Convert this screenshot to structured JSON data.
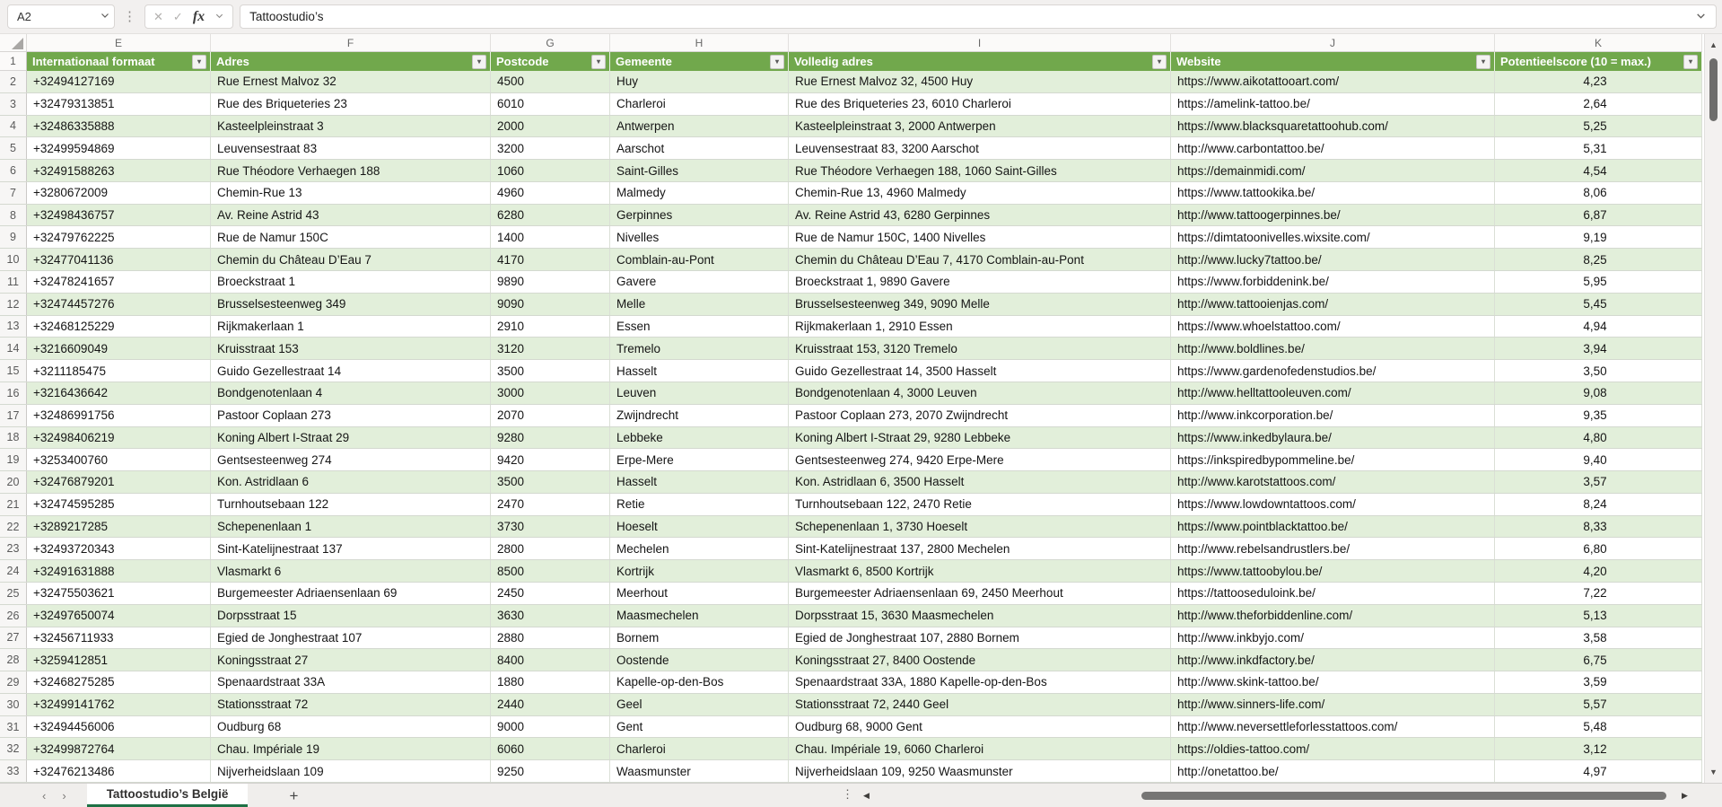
{
  "name_box": {
    "value": "A2"
  },
  "formula_bar": {
    "value": "Tattoostudio’s"
  },
  "column_letters": [
    "E",
    "F",
    "G",
    "H",
    "I",
    "J",
    "K"
  ],
  "table": {
    "header_row_number": "1",
    "headers": [
      "Internationaal formaat",
      "Adres",
      "Postcode",
      "Gemeente",
      "Volledig adres",
      "Website",
      "Potentieelscore (10 = max.)"
    ],
    "rows": [
      [
        "+32494127169",
        "Rue Ernest Malvoz 32",
        "4500",
        "Huy",
        "Rue Ernest Malvoz 32, 4500 Huy",
        "https://www.aikotattooart.com/",
        "4,23"
      ],
      [
        "+32479313851",
        "Rue des Briqueteries 23",
        "6010",
        "Charleroi",
        "Rue des Briqueteries 23, 6010 Charleroi",
        "https://amelink-tattoo.be/",
        "2,64"
      ],
      [
        "+32486335888",
        "Kasteelpleinstraat 3",
        "2000",
        "Antwerpen",
        "Kasteelpleinstraat 3, 2000 Antwerpen",
        "https://www.blacksquaretattoohub.com/",
        "5,25"
      ],
      [
        "+32499594869",
        "Leuvensestraat 83",
        "3200",
        "Aarschot",
        "Leuvensestraat 83, 3200 Aarschot",
        "http://www.carbontattoo.be/",
        "5,31"
      ],
      [
        "+32491588263",
        "Rue Théodore Verhaegen 188",
        "1060",
        "Saint-Gilles",
        "Rue Théodore Verhaegen 188, 1060 Saint-Gilles",
        "https://demainmidi.com/",
        "4,54"
      ],
      [
        "+3280672009",
        "Chemin-Rue 13",
        "4960",
        "Malmedy",
        "Chemin-Rue 13, 4960 Malmedy",
        "https://www.tattookika.be/",
        "8,06"
      ],
      [
        "+32498436757",
        "Av. Reine Astrid 43",
        "6280",
        "Gerpinnes",
        "Av. Reine Astrid 43, 6280 Gerpinnes",
        "http://www.tattoogerpinnes.be/",
        "6,87"
      ],
      [
        "+32479762225",
        "Rue de Namur 150C",
        "1400",
        "Nivelles",
        "Rue de Namur 150C, 1400 Nivelles",
        "https://dimtatoonivelles.wixsite.com/",
        "9,19"
      ],
      [
        "+32477041136",
        "Chemin du Château D’Eau 7",
        "4170",
        "Comblain-au-Pont",
        "Chemin du Château D’Eau 7, 4170 Comblain-au-Pont",
        "http://www.lucky7tattoo.be/",
        "8,25"
      ],
      [
        "+32478241657",
        "Broeckstraat 1",
        "9890",
        "Gavere",
        "Broeckstraat 1, 9890 Gavere",
        "https://www.forbiddenink.be/",
        "5,95"
      ],
      [
        "+32474457276",
        "Brusselsesteenweg 349",
        "9090",
        "Melle",
        "Brusselsesteenweg 349, 9090 Melle",
        "http://www.tattooienjas.com/",
        "5,45"
      ],
      [
        "+32468125229",
        "Rijkmakerlaan 1",
        "2910",
        "Essen",
        "Rijkmakerlaan 1, 2910 Essen",
        "https://www.whoelstattoo.com/",
        "4,94"
      ],
      [
        "+3216609049",
        "Kruisstraat 153",
        "3120",
        "Tremelo",
        "Kruisstraat 153, 3120 Tremelo",
        "http://www.boldlines.be/",
        "3,94"
      ],
      [
        "+3211185475",
        "Guido Gezellestraat 14",
        "3500",
        "Hasselt",
        "Guido Gezellestraat 14, 3500 Hasselt",
        "https://www.gardenofedenstudios.be/",
        "3,50"
      ],
      [
        "+3216436642",
        "Bondgenotenlaan 4",
        "3000",
        "Leuven",
        "Bondgenotenlaan 4, 3000 Leuven",
        "http://www.helltattooleuven.com/",
        "9,08"
      ],
      [
        "+32486991756",
        "Pastoor Coplaan 273",
        "2070",
        "Zwijndrecht",
        "Pastoor Coplaan 273, 2070 Zwijndrecht",
        "http://www.inkcorporation.be/",
        "9,35"
      ],
      [
        "+32498406219",
        "Koning Albert I-Straat 29",
        "9280",
        "Lebbeke",
        "Koning Albert I-Straat 29, 9280 Lebbeke",
        "https://www.inkedbylaura.be/",
        "4,80"
      ],
      [
        "+3253400760",
        "Gentsesteenweg 274",
        "9420",
        "Erpe-Mere",
        "Gentsesteenweg 274, 9420 Erpe-Mere",
        "https://inkspiredbypommeline.be/",
        "9,40"
      ],
      [
        "+32476879201",
        "Kon. Astridlaan 6",
        "3500",
        "Hasselt",
        "Kon. Astridlaan 6, 3500 Hasselt",
        "http://www.karotstattoos.com/",
        "3,57"
      ],
      [
        "+32474595285",
        "Turnhoutsebaan 122",
        "2470",
        "Retie",
        "Turnhoutsebaan 122, 2470 Retie",
        "https://www.lowdowntattoos.com/",
        "8,24"
      ],
      [
        "+3289217285",
        "Schepenenlaan 1",
        "3730",
        "Hoeselt",
        "Schepenenlaan 1, 3730 Hoeselt",
        "https://www.pointblacktattoo.be/",
        "8,33"
      ],
      [
        "+32493720343",
        "Sint-Katelijnestraat 137",
        "2800",
        "Mechelen",
        "Sint-Katelijnestraat 137, 2800 Mechelen",
        "http://www.rebelsandrustlers.be/",
        "6,80"
      ],
      [
        "+32491631888",
        "Vlasmarkt 6",
        "8500",
        "Kortrijk",
        "Vlasmarkt 6, 8500 Kortrijk",
        "https://www.tattoobylou.be/",
        "4,20"
      ],
      [
        "+32475503621",
        "Burgemeester Adriaensenlaan 69",
        "2450",
        "Meerhout",
        "Burgemeester Adriaensenlaan 69, 2450 Meerhout",
        "https://tattooseduloink.be/",
        "7,22"
      ],
      [
        "+32497650074",
        "Dorpsstraat 15",
        "3630",
        "Maasmechelen",
        "Dorpsstraat 15, 3630 Maasmechelen",
        "http://www.theforbiddenline.com/",
        "5,13"
      ],
      [
        "+32456711933",
        "Egied de Jonghestraat 107",
        "2880",
        "Bornem",
        "Egied de Jonghestraat 107, 2880 Bornem",
        "http://www.inkbyjo.com/",
        "3,58"
      ],
      [
        "+3259412851",
        "Koningsstraat 27",
        "8400",
        "Oostende",
        "Koningsstraat 27, 8400 Oostende",
        "http://www.inkdfactory.be/",
        "6,75"
      ],
      [
        "+32468275285",
        "Spenaardstraat 33A",
        "1880",
        "Kapelle-op-den-Bos",
        "Spenaardstraat 33A, 1880 Kapelle-op-den-Bos",
        "http://www.skink-tattoo.be/",
        "3,59"
      ],
      [
        "+32499141762",
        "Stationsstraat 72",
        "2440",
        "Geel",
        "Stationsstraat 72, 2440 Geel",
        "http://www.sinners-life.com/",
        "5,57"
      ],
      [
        "+32494456006",
        "Oudburg 68",
        "9000",
        "Gent",
        "Oudburg 68, 9000 Gent",
        "http://www.neversettleforlesstattoos.com/",
        "5,48"
      ],
      [
        "+32499872764",
        "Chau. Impériale 19",
        "6060",
        "Charleroi",
        "Chau. Impériale 19, 6060 Charleroi",
        "https://oldies-tattoo.com/",
        "3,12"
      ],
      [
        "+32476213486",
        "Nijverheidslaan 109",
        "9250",
        "Waasmunster",
        "Nijverheidslaan 109, 9250 Waasmunster",
        "http://onetattoo.be/",
        "4,97"
      ]
    ],
    "first_data_row_number": 2
  },
  "sheet_bar": {
    "active_tab": "Tattoostudio’s België",
    "add_sheet": "+"
  },
  "colors": {
    "header_green": "#71A84C",
    "band_green": "#E2EFDA",
    "tab_underline_green": "#1E7145"
  }
}
